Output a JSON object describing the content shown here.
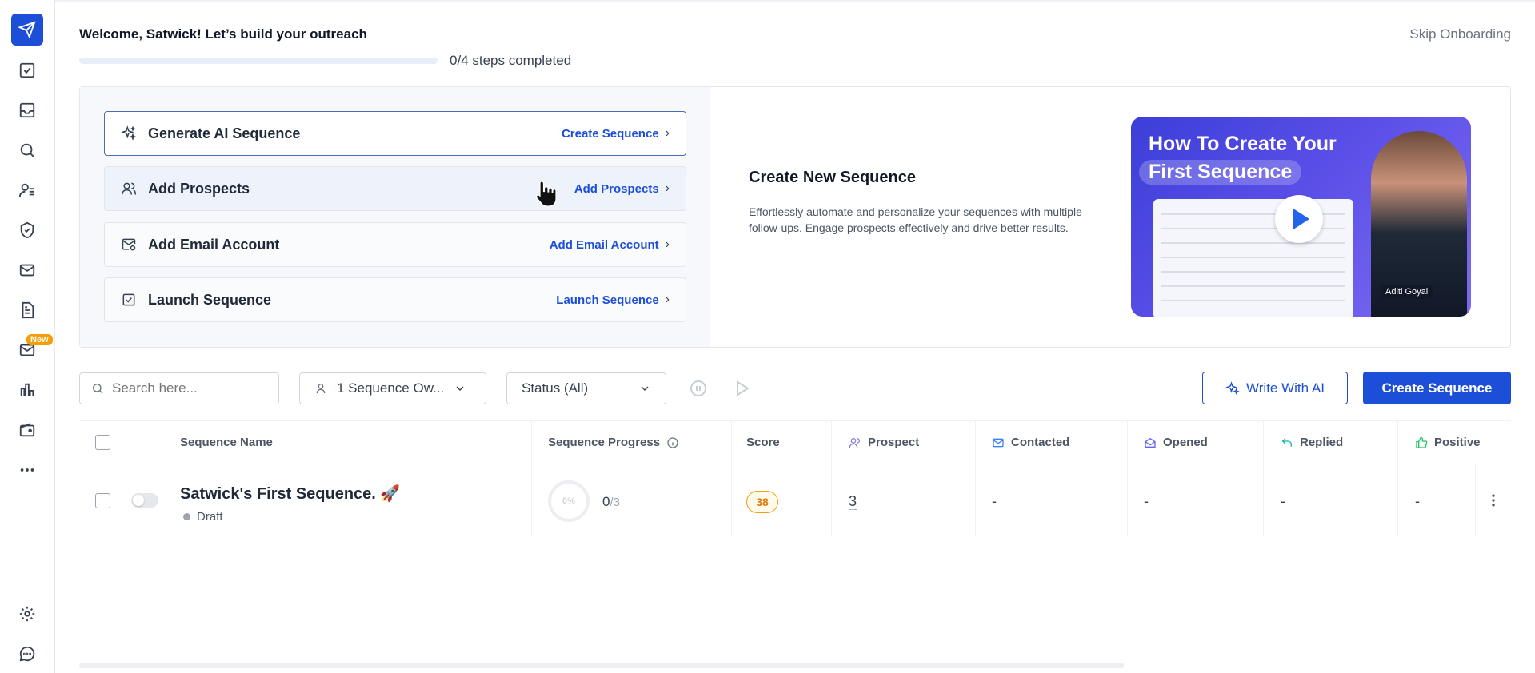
{
  "header": {
    "welcome": "Welcome, Satwick! Let’s build your outreach",
    "skip": "Skip Onboarding",
    "progress_text": "0/4 steps completed",
    "progress_fraction": 0
  },
  "steps": [
    {
      "label": "Generate AI Sequence",
      "link": "Create Sequence",
      "icon": "sparkle-icon"
    },
    {
      "label": "Add Prospects",
      "link": "Add Prospects",
      "icon": "users-icon"
    },
    {
      "label": "Add Email Account",
      "link": "Add Email Account",
      "icon": "mail-gear-icon"
    },
    {
      "label": "Launch Sequence",
      "link": "Launch Sequence",
      "icon": "check-square-icon"
    }
  ],
  "info": {
    "title": "Create New Sequence",
    "description": "Effortlessly automate and personalize your sequences with multiple follow-ups. Engage prospects effectively and drive better results."
  },
  "video": {
    "title_line1": "How To Create Your",
    "title_line2": "First Sequence",
    "presenter": "Aditi Goyal"
  },
  "sidebar": {
    "new_badge": "New"
  },
  "toolbar": {
    "search_placeholder": "Search here...",
    "owner_filter": "1 Sequence Ow...",
    "status_filter": "Status (All)",
    "write_ai": "Write With AI",
    "create_sequence": "Create Sequence"
  },
  "table": {
    "headers": {
      "name": "Sequence Name",
      "progress": "Sequence Progress",
      "score": "Score",
      "prospect": "Prospect",
      "contacted": "Contacted",
      "opened": "Opened",
      "replied": "Replied",
      "positive": "Positive"
    },
    "rows": [
      {
        "name": "Satwick's First Sequence. 🚀",
        "status": "Draft",
        "progress_pct": "0%",
        "progress_num": "0",
        "progress_den": "/3",
        "score": "38",
        "prospect": "3",
        "contacted": "-",
        "opened": "-",
        "replied": "-",
        "positive": "-"
      }
    ]
  }
}
